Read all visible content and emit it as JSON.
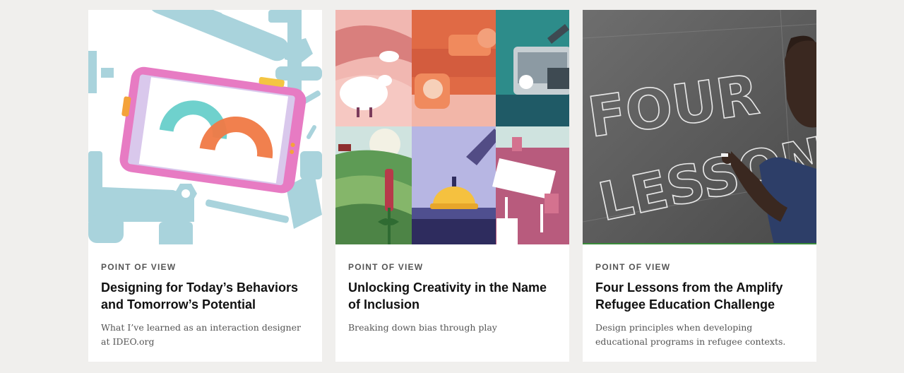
{
  "cards": [
    {
      "eyebrow": "POINT OF VIEW",
      "title": "Designing for Today’s Behaviors and Tomorrow’s Potential",
      "description": "What I’ve learned as an interaction designer at IDEO.org",
      "image": "illustration-phone-with-tools"
    },
    {
      "eyebrow": "POINT OF VIEW",
      "title": "Unlocking Creativity in the Name of Inclusion",
      "description": "Breaking down bias through play",
      "image": "illustration-collage-grid"
    },
    {
      "eyebrow": "POINT OF VIEW",
      "title": "Four Lessons from the Amplify Refugee Education Challenge",
      "description": "Design principles when developing educational programs in refugee contexts.",
      "image": "photo-chalkboard-four-lessons",
      "chalk_text": [
        "FOUR",
        "LESSONS"
      ]
    }
  ]
}
